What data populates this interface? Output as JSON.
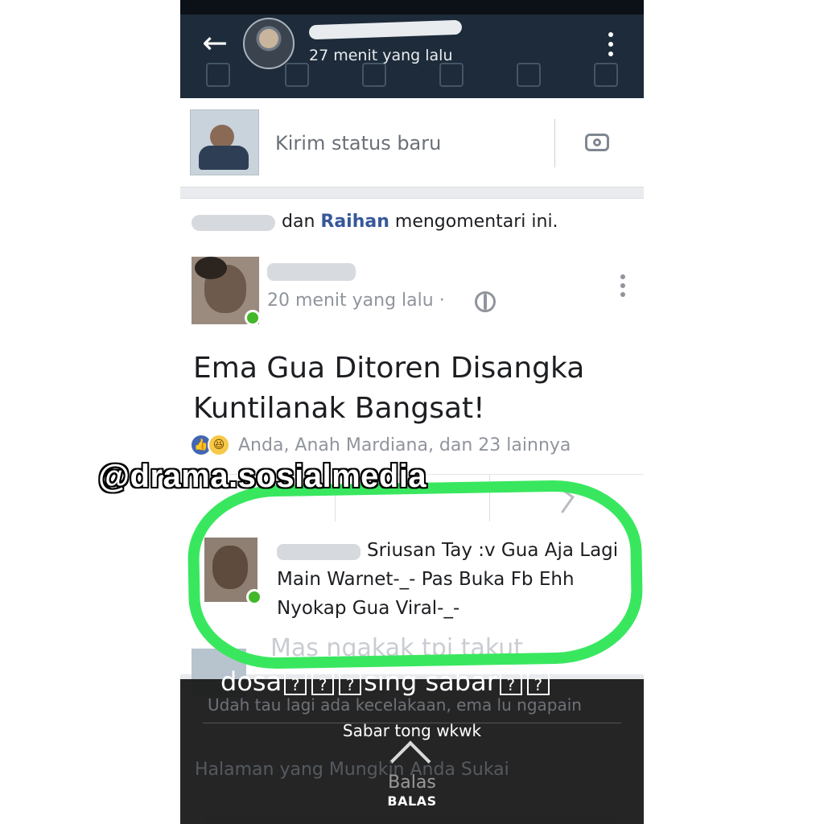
{
  "story_header": {
    "time": "27 menit yang lalu"
  },
  "composer": {
    "placeholder": "Kirim status baru"
  },
  "activity": {
    "connector": "dan",
    "name": "Raihan",
    "action": "mengomentari ini."
  },
  "post": {
    "time": "20 menit yang lalu",
    "separator": "·",
    "text": "Ema Gua Ditoren Disangka Kuntilanak Bangsat!",
    "reactions": "Anda, Anah Mardiana, dan 23 lainnya"
  },
  "watermark": "@drama.sosialmedia",
  "comment": {
    "text": "Sriusan Tay :v Gua Aja Lagi Main Warnet-_- Pas Buka Fb Ehh Nyokap Gua Viral-_-"
  },
  "comment2": {
    "text": "Mas ngakak tpi takut"
  },
  "caption": {
    "part1": "dosa",
    "part2": "sing sabar",
    "box_glyph": "?"
  },
  "reply_panel": {
    "ghost_line": "Udah tau lagi ada kecelakaan, ema lu ngapain",
    "preview": "Sabar tong wkwk",
    "section_ghost": "Halaman yang Mungkin Anda Sukai",
    "reply_big": "Balas",
    "reply_button": "BALAS"
  },
  "colors": {
    "highlight_ring": "#39e75f",
    "link_blue": "#365899",
    "online_green": "#42b72a"
  }
}
